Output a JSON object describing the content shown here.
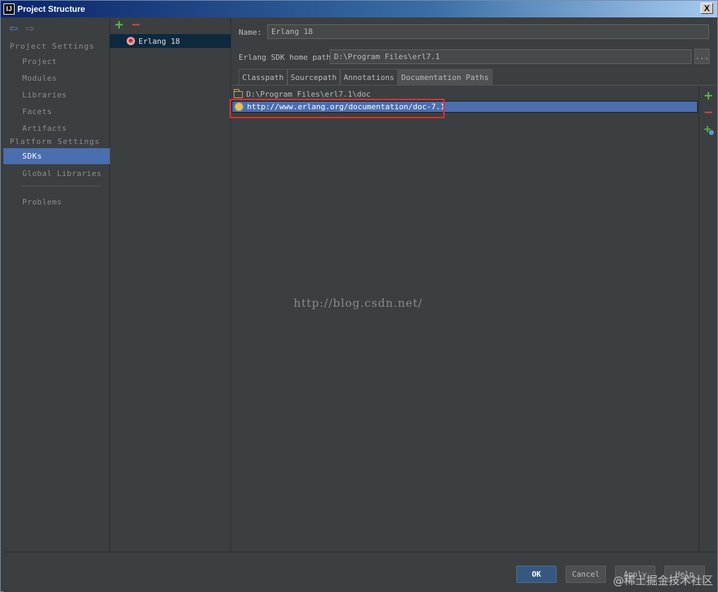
{
  "window": {
    "title": "Project Structure",
    "app_icon": "IJ",
    "close_label": "X"
  },
  "sidebar": {
    "project_settings_heading": "Project Settings",
    "platform_settings_heading": "Platform Settings",
    "items": [
      {
        "label": "Project"
      },
      {
        "label": "Modules"
      },
      {
        "label": "Libraries"
      },
      {
        "label": "Facets"
      },
      {
        "label": "Artifacts"
      },
      {
        "label": "SDKs",
        "selected": true
      },
      {
        "label": "Global Libraries"
      },
      {
        "label": "Problems"
      }
    ]
  },
  "sdk_list": {
    "items": [
      {
        "label": "Erlang 18",
        "icon_letter": "e"
      }
    ]
  },
  "form": {
    "name_label": "Name:",
    "name_value": "Erlang 18",
    "home_label": "Erlang SDK home path:",
    "home_value": "D:\\Program Files\\erl7.1",
    "browse_label": "..."
  },
  "tabs": [
    {
      "label": "Classpath"
    },
    {
      "label": "Sourcepath"
    },
    {
      "label": "Annotations"
    },
    {
      "label": "Documentation Paths",
      "active": true
    }
  ],
  "doc_paths": [
    {
      "path": "D:\\Program Files\\erl7.1\\doc",
      "icon": "folder-icon"
    },
    {
      "path": "http://www.erlang.org/documentation/doc-7.1",
      "icon": "web-icon",
      "selected": true
    }
  ],
  "watermark": "http://blog.csdn.net/",
  "buttons": {
    "ok": "OK",
    "cancel": "Cancel",
    "apply": "Apply",
    "help": "Help"
  },
  "corner_mark": "@稀土掘金技术社区",
  "colors": {
    "selection": "#4b6eaf",
    "highlight": "#e03030",
    "add": "#5ebc4a",
    "remove": "#d54b4b"
  }
}
